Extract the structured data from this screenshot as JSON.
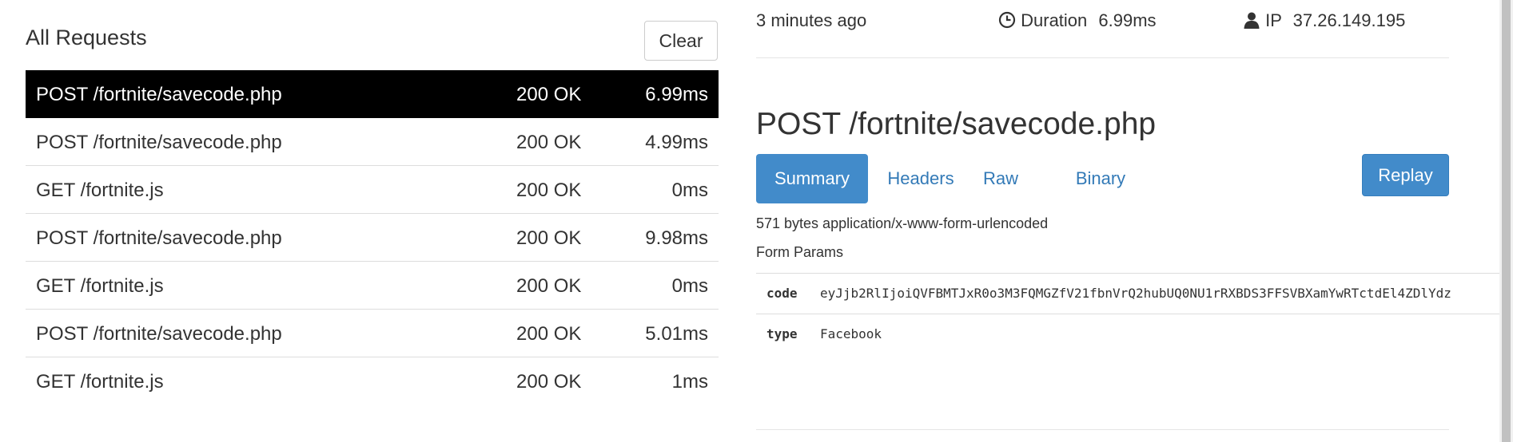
{
  "left_panel": {
    "title": "All Requests",
    "clear_label": "Clear",
    "requests": [
      {
        "path": "POST /fortnite/savecode.php",
        "status": "200 OK",
        "duration": "6.99ms",
        "active": true
      },
      {
        "path": "POST /fortnite/savecode.php",
        "status": "200 OK",
        "duration": "4.99ms",
        "active": false
      },
      {
        "path": "GET /fortnite.js",
        "status": "200 OK",
        "duration": "0ms",
        "active": false
      },
      {
        "path": "POST /fortnite/savecode.php",
        "status": "200 OK",
        "duration": "9.98ms",
        "active": false
      },
      {
        "path": "GET /fortnite.js",
        "status": "200 OK",
        "duration": "0ms",
        "active": false
      },
      {
        "path": "POST /fortnite/savecode.php",
        "status": "200 OK",
        "duration": "5.01ms",
        "active": false
      },
      {
        "path": "GET /fortnite.js",
        "status": "200 OK",
        "duration": "1ms",
        "active": false
      }
    ]
  },
  "detail": {
    "time_ago": "3 minutes ago",
    "duration_label": "Duration",
    "duration_value": "6.99ms",
    "ip_label": "IP",
    "ip_value": "37.26.149.195",
    "title": "POST /fortnite/savecode.php",
    "tabs": [
      {
        "label": "Summary",
        "active": true
      },
      {
        "label": "Headers",
        "active": false
      },
      {
        "label": "Raw",
        "active": false
      },
      {
        "label": "Binary",
        "active": false
      }
    ],
    "replay_label": "Replay",
    "body_info": "571 bytes application/x-www-form-urlencoded",
    "form_params_label": "Form Params",
    "params": [
      {
        "key": "code",
        "value": "eyJjb2RlIjoiQVFBMTJxR0o3M3FQMGZfV21fbnVrQ2hubUQ0NU1rRXBDS3FFSVBXamYwRTctdEl4ZDlYdz"
      },
      {
        "key": "type",
        "value": "Facebook"
      }
    ],
    "icons": {
      "clock": "clock-icon",
      "user": "user-icon"
    }
  },
  "colors": {
    "active_row_bg": "#000000",
    "tab_active_bg": "#428bca",
    "link": "#337ab7",
    "replay_bg": "#428bca"
  }
}
